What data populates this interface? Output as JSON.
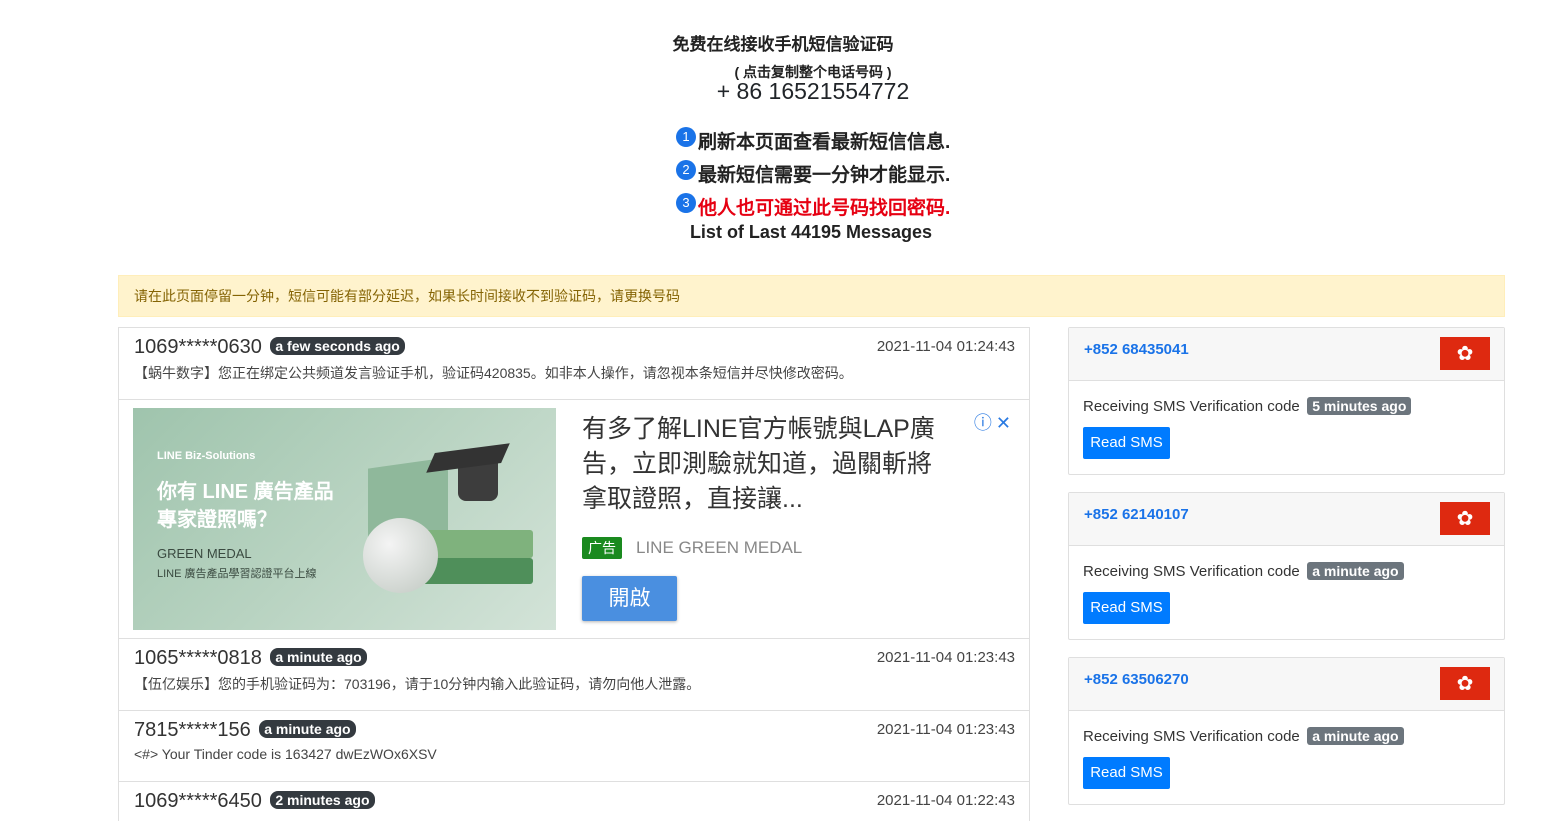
{
  "header": {
    "title": "免费在线接收手机短信验证码",
    "copy_hint": "( 点击复制整个电话号码 )",
    "phone_number": "+ 86 16521554772",
    "notes": [
      {
        "num": "1",
        "text": "刷新本页面查看最新短信信息."
      },
      {
        "num": "2",
        "text": "最新短信需要一分钟才能显示."
      },
      {
        "num": "3",
        "text": "他人也可通过此号码找回密码."
      }
    ],
    "message_count": "List of Last 44195 Messages"
  },
  "alert": "请在此页面停留一分钟，短信可能有部分延迟，如果长时间接收不到验证码，请更换号码",
  "messages": [
    {
      "sender": "1069*****0630",
      "ago": "a few seconds ago",
      "time": "2021-11-04 01:24:43",
      "text": "【蜗牛数字】您正在绑定公共频道发言验证手机，验证码420835。如非本人操作，请忽视本条短信并尽快修改密码。"
    },
    {
      "sender": "1065*****0818",
      "ago": "a minute ago",
      "time": "2021-11-04 01:23:43",
      "text": "【伍亿娱乐】您的手机验证码为：703196，请于10分钟内输入此验证码，请勿向他人泄露。"
    },
    {
      "sender": "7815*****156",
      "ago": "a minute ago",
      "time": "2021-11-04 01:23:43",
      "text": "<#> Your Tinder code is 163427 dwEzWOx6XSV"
    },
    {
      "sender": "1069*****6450",
      "ago": "2 minutes ago",
      "time": "2021-11-04 01:22:43",
      "text": ""
    }
  ],
  "ad": {
    "brand": "LINE Biz-Solutions",
    "headline_1": "你有 LINE 廣告產品",
    "headline_2": "專家證照嗎？",
    "sub_1": "GREEN MEDAL",
    "sub_2": "LINE 廣告產品學習認證平台上線",
    "copy": "有多了解LINE官方帳號與LAP廣告，立即測驗就知道，過關斬將拿取證照，直接讓...",
    "tag_label": "广告",
    "advertiser": "LINE GREEN MEDAL",
    "open_label": "開啟",
    "info_icons": "ⓘ✕"
  },
  "sidebar": {
    "cards": [
      {
        "phone": "+852 68435041",
        "text": "Receiving SMS Verification code",
        "ago": "5 minutes ago",
        "button": "Read SMS",
        "flag": "✿"
      },
      {
        "phone": "+852 62140107",
        "text": "Receiving SMS Verification code",
        "ago": "a minute ago",
        "button": "Read SMS",
        "flag": "✿"
      },
      {
        "phone": "+852 63506270",
        "text": "Receiving SMS Verification code",
        "ago": "a minute ago",
        "button": "Read SMS",
        "flag": "✿"
      }
    ]
  },
  "colors": {
    "accent": "#007bff",
    "warning_bg": "#fff3cd",
    "warning_text": "#856404",
    "note_red": "#e60012",
    "flag_red": "#de2910"
  }
}
